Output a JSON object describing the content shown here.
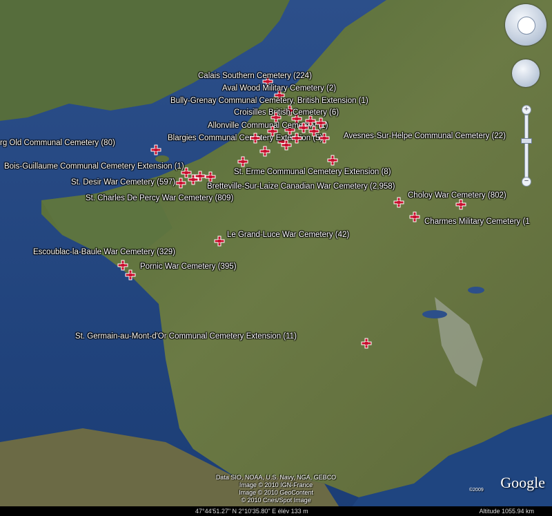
{
  "markers": [
    {
      "label": "Calais Southern Cemetery (224)"
    },
    {
      "label": "Aval Wood Military Cemetery (2)"
    },
    {
      "label": "Bully-Grenay Communal Cemetery, British Extension (1)"
    },
    {
      "label": "Croisilles British Cemetery (6)"
    },
    {
      "label": "Allonville Communal Cemetery (1)"
    },
    {
      "label": "Blargies Communal Cemetery Extension (5)"
    },
    {
      "label": "Avesnes-Sur-Helpe Communal Cemetery (22)"
    },
    {
      "label": "rg Old Communal Cemetery (80)"
    },
    {
      "label": "Bois-Guillaume Communal Cemetery Extension (1)"
    },
    {
      "label": "St. Erme Communal Cemetery Extension (8)"
    },
    {
      "label": "St. Desir War Cemetery (597)"
    },
    {
      "label": "Bretteville-Sur-Laize Canadian War Cemetery (2,958)"
    },
    {
      "label": "St. Charles De Percy War Cemetery (809)"
    },
    {
      "label": "Choloy War Cemetery (802)"
    },
    {
      "label": "Charmes Military Cemetery (1"
    },
    {
      "label": "Le Grand-Luce War Cemetery (42)"
    },
    {
      "label": "Escoublac-la-Baule War Cemetery (329)"
    },
    {
      "label": "Pornic War Cemetery (395)"
    },
    {
      "label": "St. Germain-au-Mont-d'Or Communal Cemetery Extension (11)"
    }
  ],
  "attribution": {
    "line1": "Data SIO, NOAA, U.S. Navy, NGA, GEBCO",
    "line2": "Image © 2010 IGN-France",
    "line3": "Image © 2010 GeoContent",
    "line4": "© 2010 Cnes/Spot Image"
  },
  "brand": {
    "logo": "Google",
    "copyright": "©2009"
  },
  "status": {
    "coordinates": "47°44'51.27\" N    2°10'35.80\" E    élév   133 m",
    "altitude": "Altitude  1055.94 km"
  },
  "controls": {
    "zoom_in": "+",
    "zoom_out": "−"
  },
  "icons": {
    "marker": "red-cross-marker-icon",
    "compass": "compass-icon",
    "look": "look-around-icon"
  }
}
